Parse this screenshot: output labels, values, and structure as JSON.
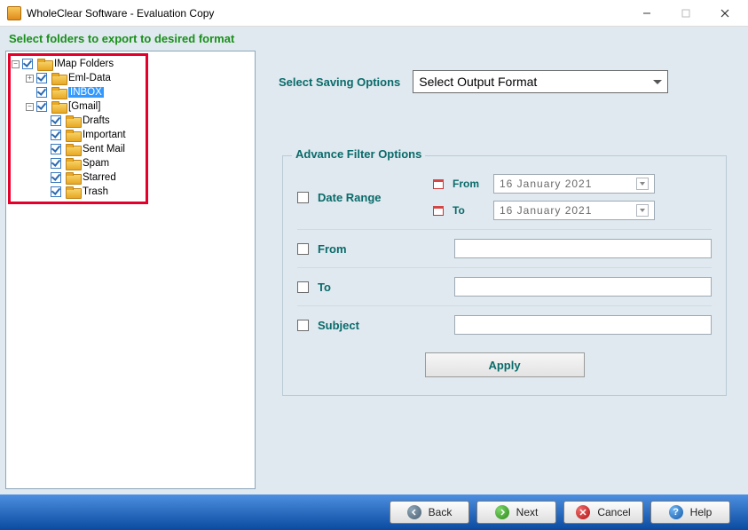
{
  "window": {
    "title": "WholeClear Software - Evaluation Copy"
  },
  "instruction": "Select folders to export to desired format",
  "tree": {
    "root": {
      "label": "IMap Folders",
      "children": [
        {
          "label": "Eml-Data"
        },
        {
          "label": "INBOX",
          "selected": true
        },
        {
          "label": "[Gmail]",
          "children": [
            {
              "label": "Drafts"
            },
            {
              "label": "Important"
            },
            {
              "label": "Sent Mail"
            },
            {
              "label": "Spam"
            },
            {
              "label": "Starred"
            },
            {
              "label": "Trash"
            }
          ]
        }
      ]
    }
  },
  "saving": {
    "label": "Select Saving Options",
    "placeholder": "Select Output Format"
  },
  "filters": {
    "legend": "Advance Filter Options",
    "date_range": {
      "label": "Date Range",
      "from_label": "From",
      "to_label": "To",
      "from_value": "16  January  2021",
      "to_value": "16  January  2021"
    },
    "from": {
      "label": "From",
      "value": ""
    },
    "to": {
      "label": "To",
      "value": ""
    },
    "subject": {
      "label": "Subject",
      "value": ""
    },
    "apply": "Apply"
  },
  "footer": {
    "back": "Back",
    "next": "Next",
    "cancel": "Cancel",
    "help": "Help"
  }
}
